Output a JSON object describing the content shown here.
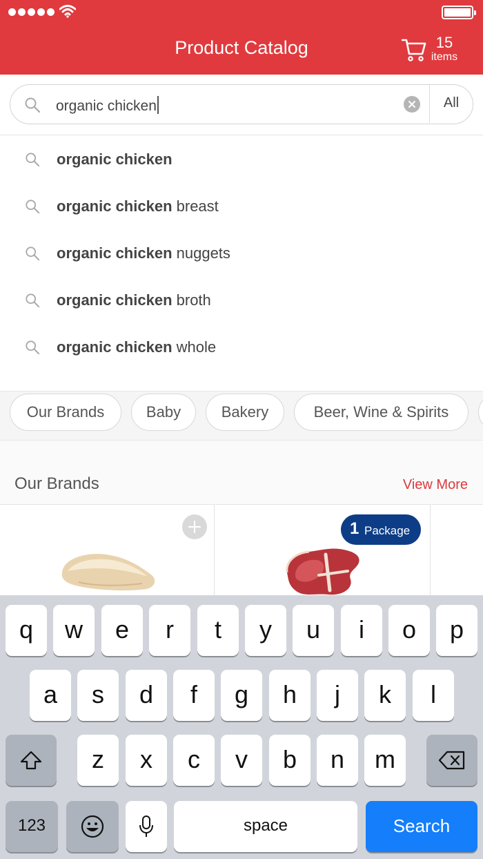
{
  "header": {
    "title": "Product Catalog",
    "cart_count": "15",
    "cart_unit": "items",
    "background": "#e03a3e"
  },
  "search": {
    "value": "organic chicken",
    "scope": "All"
  },
  "suggestions": [
    {
      "bold": "organic chicken",
      "rest": ""
    },
    {
      "bold": "organic chicken",
      "rest": " breast"
    },
    {
      "bold": "organic chicken",
      "rest": " nuggets"
    },
    {
      "bold": "organic chicken",
      "rest": " broth"
    },
    {
      "bold": "organic chicken",
      "rest": " whole"
    }
  ],
  "categories": [
    "Our Brands",
    "Baby",
    "Bakery",
    "Beer, Wine & Spirits"
  ],
  "brands": {
    "title": "Our Brands",
    "view_more": "View More",
    "products": [
      {
        "image": "chicken-breast",
        "action": "add-icon"
      },
      {
        "image": "t-bone-steak",
        "quantity": "1",
        "unit": "Package"
      }
    ]
  },
  "keyboard": {
    "row1": [
      "q",
      "w",
      "e",
      "r",
      "t",
      "y",
      "u",
      "i",
      "o",
      "p"
    ],
    "row2": [
      "a",
      "s",
      "d",
      "f",
      "g",
      "h",
      "j",
      "k",
      "l"
    ],
    "row3": [
      "z",
      "x",
      "c",
      "v",
      "b",
      "n",
      "m"
    ],
    "numbers_label": "123",
    "space_label": "space",
    "search_label": "Search",
    "search_color": "#147efb"
  }
}
